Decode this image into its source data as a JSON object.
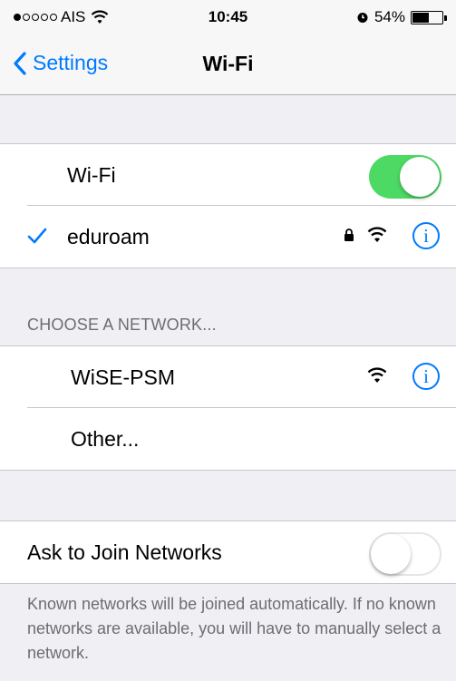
{
  "status_bar": {
    "carrier": "AIS",
    "signal_filled": 1,
    "signal_total": 5,
    "time": "10:45",
    "battery_percent_text": "54%",
    "battery_level": 0.54,
    "icons": [
      "signal-dots-icon",
      "wifi-icon",
      "alarm-icon",
      "battery-icon"
    ]
  },
  "nav": {
    "back_label": "Settings",
    "title": "Wi-Fi"
  },
  "wifi_group": {
    "toggle_label": "Wi-Fi",
    "toggle_on": true,
    "connected_network": "eduroam",
    "connected_secured": true
  },
  "choose_section": {
    "header": "CHOOSE A NETWORK...",
    "networks": [
      {
        "name": "WiSE-PSM",
        "secured": false
      }
    ],
    "other_label": "Other..."
  },
  "ask_join": {
    "label": "Ask to Join Networks",
    "toggle_on": false,
    "note": "Known networks will be joined automatically. If no known networks are available, you will have to manually select a network."
  },
  "colors": {
    "accent": "#007aff",
    "toggle_on": "#4cd964",
    "background": "#efeff4"
  }
}
